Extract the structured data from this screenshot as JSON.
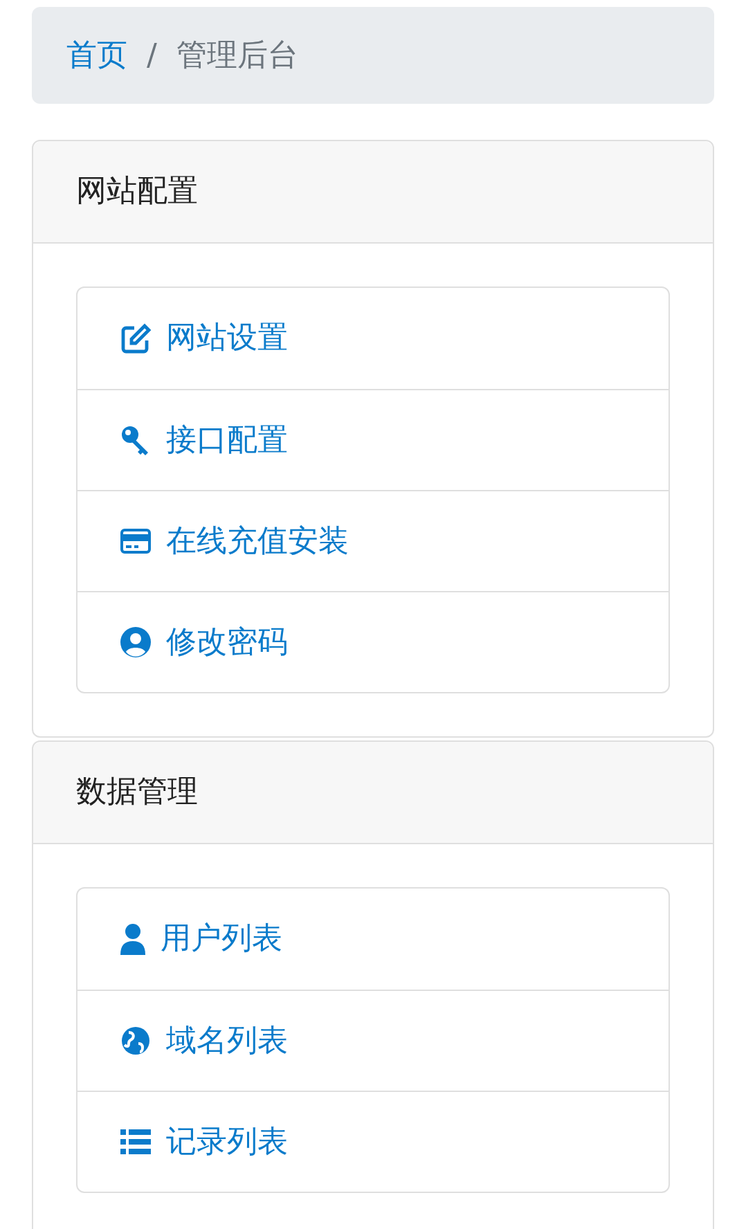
{
  "breadcrumb": [
    {
      "label": "首页",
      "kind": "link"
    },
    {
      "label": "管理后台",
      "kind": "current"
    }
  ],
  "breadcrumb_separator": "/",
  "panels": [
    {
      "title": "网站配置",
      "items": [
        {
          "label": "网站设置",
          "kind": "edit"
        },
        {
          "label": "接口配置",
          "kind": "key"
        },
        {
          "label": "在线充值安装",
          "kind": "card"
        },
        {
          "label": "修改密码",
          "kind": "account"
        }
      ]
    },
    {
      "title": "数据管理",
      "items": [
        {
          "label": "用户列表",
          "kind": "user"
        },
        {
          "label": "域名列表",
          "kind": "globe"
        },
        {
          "label": "记录列表",
          "kind": "list"
        }
      ]
    }
  ]
}
